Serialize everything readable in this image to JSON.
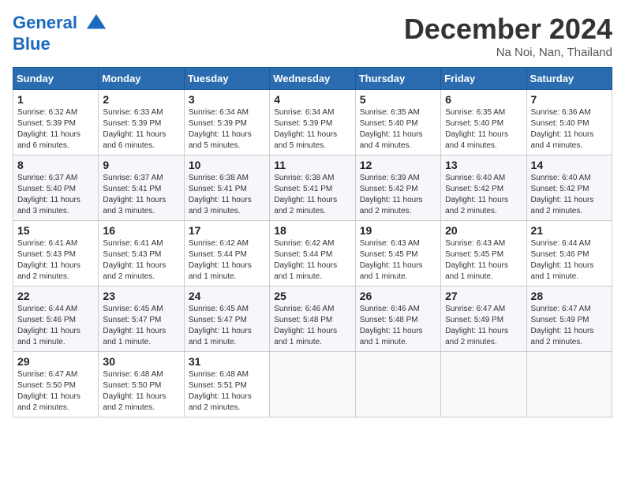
{
  "header": {
    "logo_line1": "General",
    "logo_line2": "Blue",
    "month": "December 2024",
    "location": "Na Noi, Nan, Thailand"
  },
  "weekdays": [
    "Sunday",
    "Monday",
    "Tuesday",
    "Wednesday",
    "Thursday",
    "Friday",
    "Saturday"
  ],
  "weeks": [
    [
      {
        "day": "1",
        "sunrise": "6:32 AM",
        "sunset": "5:39 PM",
        "daylight": "11 hours and 6 minutes."
      },
      {
        "day": "2",
        "sunrise": "6:33 AM",
        "sunset": "5:39 PM",
        "daylight": "11 hours and 6 minutes."
      },
      {
        "day": "3",
        "sunrise": "6:34 AM",
        "sunset": "5:39 PM",
        "daylight": "11 hours and 5 minutes."
      },
      {
        "day": "4",
        "sunrise": "6:34 AM",
        "sunset": "5:39 PM",
        "daylight": "11 hours and 5 minutes."
      },
      {
        "day": "5",
        "sunrise": "6:35 AM",
        "sunset": "5:40 PM",
        "daylight": "11 hours and 4 minutes."
      },
      {
        "day": "6",
        "sunrise": "6:35 AM",
        "sunset": "5:40 PM",
        "daylight": "11 hours and 4 minutes."
      },
      {
        "day": "7",
        "sunrise": "6:36 AM",
        "sunset": "5:40 PM",
        "daylight": "11 hours and 4 minutes."
      }
    ],
    [
      {
        "day": "8",
        "sunrise": "6:37 AM",
        "sunset": "5:40 PM",
        "daylight": "11 hours and 3 minutes."
      },
      {
        "day": "9",
        "sunrise": "6:37 AM",
        "sunset": "5:41 PM",
        "daylight": "11 hours and 3 minutes."
      },
      {
        "day": "10",
        "sunrise": "6:38 AM",
        "sunset": "5:41 PM",
        "daylight": "11 hours and 3 minutes."
      },
      {
        "day": "11",
        "sunrise": "6:38 AM",
        "sunset": "5:41 PM",
        "daylight": "11 hours and 2 minutes."
      },
      {
        "day": "12",
        "sunrise": "6:39 AM",
        "sunset": "5:42 PM",
        "daylight": "11 hours and 2 minutes."
      },
      {
        "day": "13",
        "sunrise": "6:40 AM",
        "sunset": "5:42 PM",
        "daylight": "11 hours and 2 minutes."
      },
      {
        "day": "14",
        "sunrise": "6:40 AM",
        "sunset": "5:42 PM",
        "daylight": "11 hours and 2 minutes."
      }
    ],
    [
      {
        "day": "15",
        "sunrise": "6:41 AM",
        "sunset": "5:43 PM",
        "daylight": "11 hours and 2 minutes."
      },
      {
        "day": "16",
        "sunrise": "6:41 AM",
        "sunset": "5:43 PM",
        "daylight": "11 hours and 2 minutes."
      },
      {
        "day": "17",
        "sunrise": "6:42 AM",
        "sunset": "5:44 PM",
        "daylight": "11 hours and 1 minute."
      },
      {
        "day": "18",
        "sunrise": "6:42 AM",
        "sunset": "5:44 PM",
        "daylight": "11 hours and 1 minute."
      },
      {
        "day": "19",
        "sunrise": "6:43 AM",
        "sunset": "5:45 PM",
        "daylight": "11 hours and 1 minute."
      },
      {
        "day": "20",
        "sunrise": "6:43 AM",
        "sunset": "5:45 PM",
        "daylight": "11 hours and 1 minute."
      },
      {
        "day": "21",
        "sunrise": "6:44 AM",
        "sunset": "5:46 PM",
        "daylight": "11 hours and 1 minute."
      }
    ],
    [
      {
        "day": "22",
        "sunrise": "6:44 AM",
        "sunset": "5:46 PM",
        "daylight": "11 hours and 1 minute."
      },
      {
        "day": "23",
        "sunrise": "6:45 AM",
        "sunset": "5:47 PM",
        "daylight": "11 hours and 1 minute."
      },
      {
        "day": "24",
        "sunrise": "6:45 AM",
        "sunset": "5:47 PM",
        "daylight": "11 hours and 1 minute."
      },
      {
        "day": "25",
        "sunrise": "6:46 AM",
        "sunset": "5:48 PM",
        "daylight": "11 hours and 1 minute."
      },
      {
        "day": "26",
        "sunrise": "6:46 AM",
        "sunset": "5:48 PM",
        "daylight": "11 hours and 1 minute."
      },
      {
        "day": "27",
        "sunrise": "6:47 AM",
        "sunset": "5:49 PM",
        "daylight": "11 hours and 2 minutes."
      },
      {
        "day": "28",
        "sunrise": "6:47 AM",
        "sunset": "5:49 PM",
        "daylight": "11 hours and 2 minutes."
      }
    ],
    [
      {
        "day": "29",
        "sunrise": "6:47 AM",
        "sunset": "5:50 PM",
        "daylight": "11 hours and 2 minutes."
      },
      {
        "day": "30",
        "sunrise": "6:48 AM",
        "sunset": "5:50 PM",
        "daylight": "11 hours and 2 minutes."
      },
      {
        "day": "31",
        "sunrise": "6:48 AM",
        "sunset": "5:51 PM",
        "daylight": "11 hours and 2 minutes."
      },
      null,
      null,
      null,
      null
    ]
  ]
}
